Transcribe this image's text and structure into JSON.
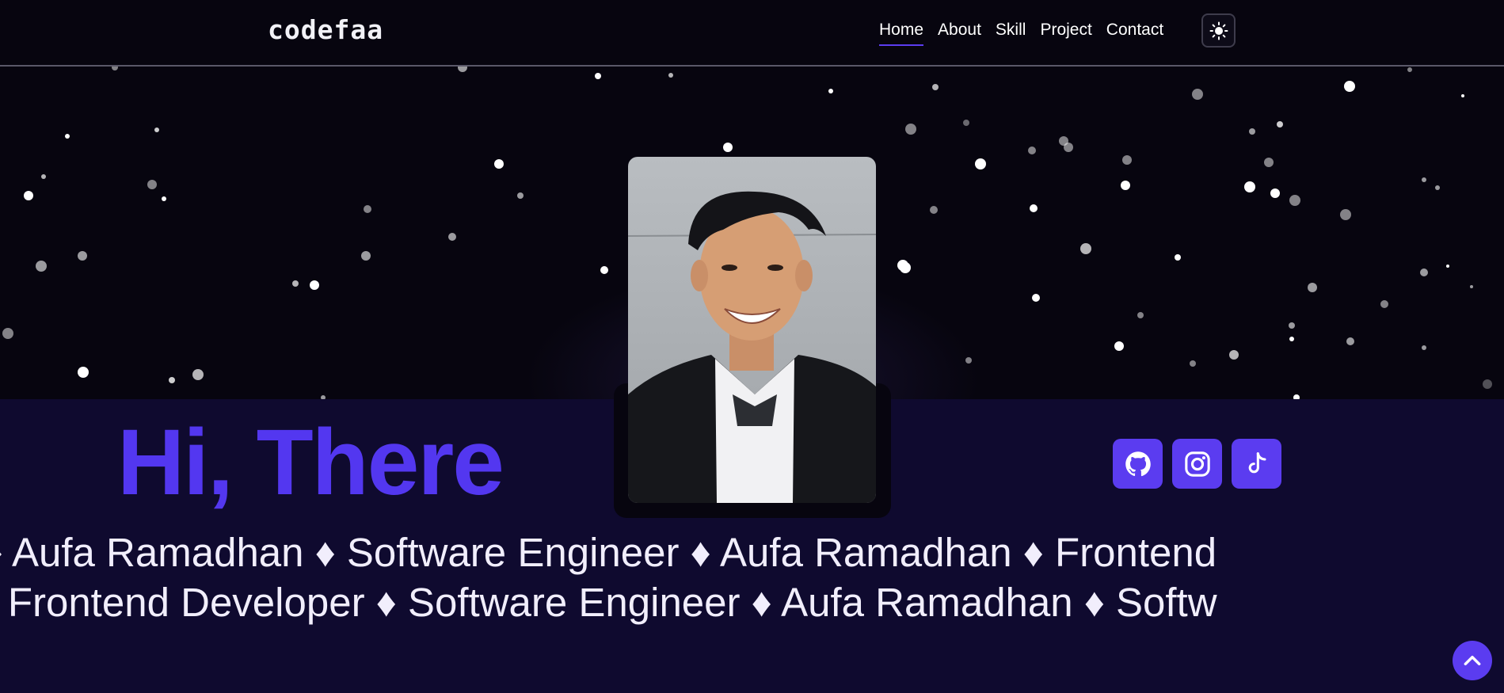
{
  "header": {
    "logo": "codefaa",
    "nav": [
      {
        "label": "Home",
        "active": true
      },
      {
        "label": "About"
      },
      {
        "label": "Skill"
      },
      {
        "label": "Project"
      },
      {
        "label": "Contact"
      }
    ],
    "theme_toggle_icon": "sun-icon"
  },
  "hero": {
    "greeting": "Hi, There",
    "photo_icon": "profile-photo",
    "socials": [
      {
        "icon": "github-icon"
      },
      {
        "icon": "instagram-icon"
      },
      {
        "icon": "tiktok-icon"
      }
    ],
    "marquee": [
      "loper ♦ Aufa Ramadhan ♦ Software Engineer ♦ Aufa Ramadhan ♦ Frontend",
      "dhan ♦ Frontend Developer ♦ Software Engineer ♦ Aufa Ramadhan ♦ Softw"
    ]
  },
  "scroll_top_icon": "chevron-up-icon",
  "colors": {
    "accent": "#5b3cf0",
    "title": "#5337f0",
    "background": "#07050f",
    "band": "#0f0a2f"
  }
}
